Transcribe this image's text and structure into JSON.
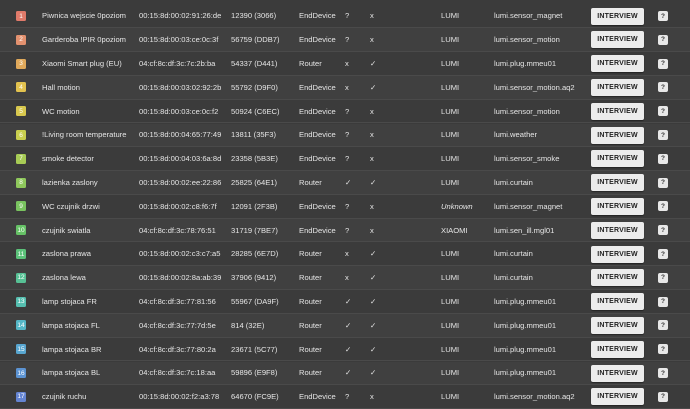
{
  "interview_label": "INTERVIEW",
  "help_label": "?",
  "rows": [
    {
      "idx": "1",
      "color": "#e07a6a",
      "name": "Piwnica wejscie 0poziom",
      "ieee": "00:15:8d:00:02:91:26:de",
      "nwk": "12390 (3066)",
      "type": "EndDevice",
      "rx": "?",
      "lq": "x",
      "manu": "LUMI",
      "model": "lumi.sensor_magnet"
    },
    {
      "idx": "2",
      "color": "#e3916f",
      "name": "Garderoba !PIR 0poziom",
      "ieee": "00:15:8d:00:03:ce:0c:3f",
      "nwk": "56759 (DDB7)",
      "type": "EndDevice",
      "rx": "?",
      "lq": "x",
      "manu": "LUMI",
      "model": "lumi.sensor_motion"
    },
    {
      "idx": "3",
      "color": "#e0a95b",
      "name": "Xiaomi Smart plug (EU)",
      "ieee": "04:cf:8c:df:3c:7c:2b:ba",
      "nwk": "54337 (D441)",
      "type": "Router",
      "rx": "x",
      "lq": "✓",
      "manu": "LUMI",
      "model": "lumi.plug.mmeu01"
    },
    {
      "idx": "4",
      "color": "#e2c24f",
      "name": "Hall motion",
      "ieee": "00:15:8d:00:03:02:92:2b",
      "nwk": "55792 (D9F0)",
      "type": "EndDevice",
      "rx": "x",
      "lq": "✓",
      "manu": "LUMI",
      "model": "lumi.sensor_motion.aq2"
    },
    {
      "idx": "5",
      "color": "#d8c84e",
      "name": "WC motion",
      "ieee": "00:15:8d:00:03:ce:0c:f2",
      "nwk": "50924 (C6EC)",
      "type": "EndDevice",
      "rx": "?",
      "lq": "x",
      "manu": "LUMI",
      "model": "lumi.sensor_motion"
    },
    {
      "idx": "6",
      "color": "#c9cf4e",
      "name": "!Living room temperature",
      "ieee": "00:15:8d:00:04:65:77:49",
      "nwk": "13811 (35F3)",
      "type": "EndDevice",
      "rx": "?",
      "lq": "x",
      "manu": "LUMI",
      "model": "lumi.weather"
    },
    {
      "idx": "7",
      "color": "#a7cb55",
      "name": "smoke detector",
      "ieee": "00:15:8d:00:04:03:6a:8d",
      "nwk": "23358 (5B3E)",
      "type": "EndDevice",
      "rx": "?",
      "lq": "x",
      "manu": "LUMI",
      "model": "lumi.sensor_smoke"
    },
    {
      "idx": "8",
      "color": "#8fc85c",
      "name": "lazienka zaslony",
      "ieee": "00:15:8d:00:02:ee:22:86",
      "nwk": "25825 (64E1)",
      "type": "Router",
      "rx": "✓",
      "lq": "✓",
      "manu": "LUMI",
      "model": "lumi.curtain"
    },
    {
      "idx": "9",
      "color": "#79c35f",
      "name": "WC czujnik drzwi",
      "ieee": "00:15:8d:00:02:c8:f6:7f",
      "nwk": "12091 (2F3B)",
      "type": "EndDevice",
      "rx": "?",
      "lq": "x",
      "manu": "Unknown",
      "model": "lumi.sensor_magnet"
    },
    {
      "idx": "10",
      "color": "#66c266",
      "name": "czujnik swiatla",
      "ieee": "04:cf:8c:df:3c:78:76:51",
      "nwk": "31719 (7BE7)",
      "type": "EndDevice",
      "rx": "?",
      "lq": "x",
      "manu": "XIAOMI",
      "model": "lumi.sen_ill.mgl01"
    },
    {
      "idx": "11",
      "color": "#5cc27a",
      "name": "zaslona prawa",
      "ieee": "00:15:8d:00:02:c3:c7:a5",
      "nwk": "28285 (6E7D)",
      "type": "Router",
      "rx": "x",
      "lq": "✓",
      "manu": "LUMI",
      "model": "lumi.curtain"
    },
    {
      "idx": "12",
      "color": "#57c195",
      "name": "zaslona lewa",
      "ieee": "00:15:8d:00:02:8a:ab:39",
      "nwk": "37906 (9412)",
      "type": "Router",
      "rx": "x",
      "lq": "✓",
      "manu": "LUMI",
      "model": "lumi.curtain"
    },
    {
      "idx": "13",
      "color": "#55bfb0",
      "name": "lamp stojaca FR",
      "ieee": "04:cf:8c:df:3c:77:81:56",
      "nwk": "55967 (DA9F)",
      "type": "Router",
      "rx": "✓",
      "lq": "✓",
      "manu": "LUMI",
      "model": "lumi.plug.mmeu01"
    },
    {
      "idx": "14",
      "color": "#55b7c7",
      "name": "lampa stojaca FL",
      "ieee": "04:cf:8c:df:3c:77:7d:5e",
      "nwk": "814 (32E)",
      "type": "Router",
      "rx": "✓",
      "lq": "✓",
      "manu": "LUMI",
      "model": "lumi.plug.mmeu01"
    },
    {
      "idx": "15",
      "color": "#58a6d0",
      "name": "lampa stojaca BR",
      "ieee": "04:cf:8c:df:3c:77:80:2a",
      "nwk": "23671 (5C77)",
      "type": "Router",
      "rx": "✓",
      "lq": "✓",
      "manu": "LUMI",
      "model": "lumi.plug.mmeu01"
    },
    {
      "idx": "16",
      "color": "#5c93d2",
      "name": "lampa stojaca BL",
      "ieee": "04:cf:8c:df:3c:7c:18:aa",
      "nwk": "59896 (E9F8)",
      "type": "Router",
      "rx": "✓",
      "lq": "✓",
      "manu": "LUMI",
      "model": "lumi.plug.mmeu01"
    },
    {
      "idx": "17",
      "color": "#6484d2",
      "name": "czujnik ruchu",
      "ieee": "00:15:8d:00:02:f2:a3:78",
      "nwk": "64670 (FC9E)",
      "type": "EndDevice",
      "rx": "?",
      "lq": "x",
      "manu": "LUMI",
      "model": "lumi.sensor_motion.aq2"
    }
  ]
}
